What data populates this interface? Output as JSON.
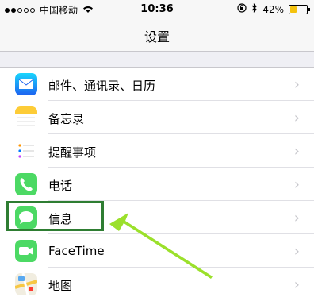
{
  "status_bar": {
    "carrier": "中国移动",
    "time": "10:36",
    "battery_percent": "42%",
    "battery_level": 0.42,
    "signal_bars_filled": 2,
    "signal_bars_total": 5
  },
  "nav": {
    "title": "设置"
  },
  "settings": {
    "items": [
      {
        "label": "邮件、通讯录、日历",
        "icon": "mail-icon"
      },
      {
        "label": "备忘录",
        "icon": "notes-icon"
      },
      {
        "label": "提醒事项",
        "icon": "reminders-icon"
      },
      {
        "label": "电话",
        "icon": "phone-icon"
      },
      {
        "label": "信息",
        "icon": "messages-icon"
      },
      {
        "label": "FaceTime",
        "icon": "facetime-icon"
      },
      {
        "label": "地图",
        "icon": "maps-icon"
      }
    ]
  },
  "colors": {
    "highlight_border": "#2e7d32",
    "arrow": "#9be02b",
    "chevron": "#c7c7cc"
  }
}
